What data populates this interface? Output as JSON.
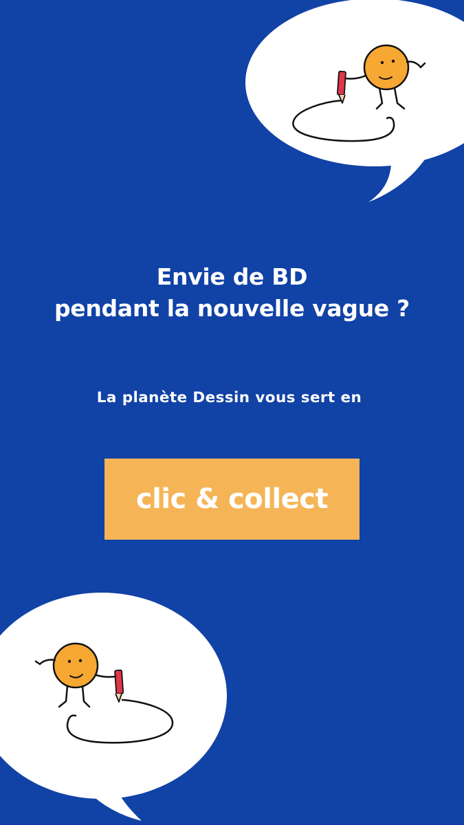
{
  "colors": {
    "background": "#1142a6",
    "bubble": "#ffffff",
    "button": "#f5b556",
    "character": "#f7a832",
    "pen": "#e0364a",
    "ink": "#111111"
  },
  "headline": {
    "line1": "Envie de BD",
    "line2": "pendant la nouvelle vague ?"
  },
  "subtitle": "La planète Dessin vous sert en",
  "cta": {
    "label": "clic & collect"
  },
  "icons": {
    "top": "drawing-character-icon",
    "bottom": "drawing-character-icon"
  }
}
